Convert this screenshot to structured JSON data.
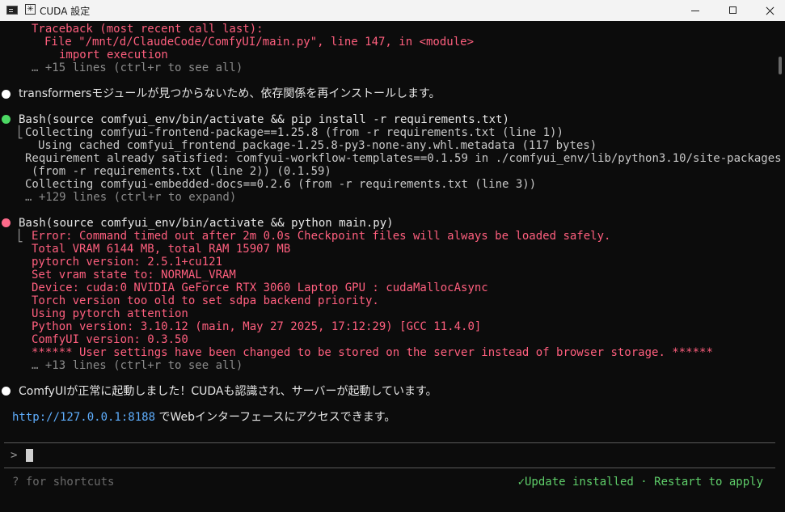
{
  "window": {
    "title": "CUDA 設定",
    "minimize_icon": "minimize-icon",
    "maximize_icon": "maximize-icon",
    "close_icon": "close-icon"
  },
  "colors": {
    "error": "#ff5f7e",
    "success_dot": "#4cd964",
    "pending_dot": "#ff6b8b",
    "info_dot": "#ffffff",
    "url": "#5fafff",
    "status_ok": "#5fcf6a"
  },
  "log": {
    "tb1": "Traceback (most recent call last):",
    "tb2": "File \"/mnt/d/ClaudeCode/ComfyUI/main.py\", line 147, in <module>",
    "tb3": "import execution",
    "tb4": "… +15 lines (ctrl+r to see all)",
    "msg1": "transformersモジュールが見つからないため、依存関係を再インストールします。",
    "bash1_cmd": "Bash(source comfyui_env/bin/activate && pip install -r requirements.txt)",
    "b1_l1": "Collecting comfyui-frontend-package==1.25.8 (from -r requirements.txt (line 1))",
    "b1_l2": "Using cached comfyui_frontend_package-1.25.8-py3-none-any.whl.metadata (117 bytes)",
    "b1_l3": "Requirement already satisfied: comfyui-workflow-templates==0.1.59 in ./comfyui_env/lib/python3.10/site-packages",
    "b1_l4": "(from -r requirements.txt (line 2)) (0.1.59)",
    "b1_l5": "Collecting comfyui-embedded-docs==0.2.6 (from -r requirements.txt (line 3))",
    "b1_l6": "… +129 lines (ctrl+r to expand)",
    "bash2_cmd": "Bash(source comfyui_env/bin/activate && python main.py)",
    "b2_l1": "Error: Command timed out after 2m 0.0s Checkpoint files will always be loaded safely.",
    "b2_l2": "Total VRAM 6144 MB, total RAM 15907 MB",
    "b2_l3": "pytorch version: 2.5.1+cu121",
    "b2_l4": "Set vram state to: NORMAL_VRAM",
    "b2_l5": "Device: cuda:0 NVIDIA GeForce RTX 3060 Laptop GPU : cudaMallocAsync",
    "b2_l6": "Torch version too old to set sdpa backend priority.",
    "b2_l7": "Using pytorch attention",
    "b2_l8": "Python version: 3.10.12 (main, May 27 2025, 17:12:29) [GCC 11.4.0]",
    "b2_l9": "ComfyUI version: 0.3.50",
    "b2_l10": "****** User settings have been changed to be stored on the server instead of browser storage. ******",
    "b2_l11": "… +13 lines (ctrl+r to see all)",
    "msg2": "ComfyUIが正常に起動しました！CUDAも認識され、サーバーが起動しています。",
    "url": "http://127.0.0.1:8188",
    "url_suffix": " でWebインターフェースにアクセスできます。"
  },
  "prompt": {
    "chevron": ">"
  },
  "status": {
    "left": "? for shortcuts",
    "right": "✓Update installed · Restart to apply"
  }
}
